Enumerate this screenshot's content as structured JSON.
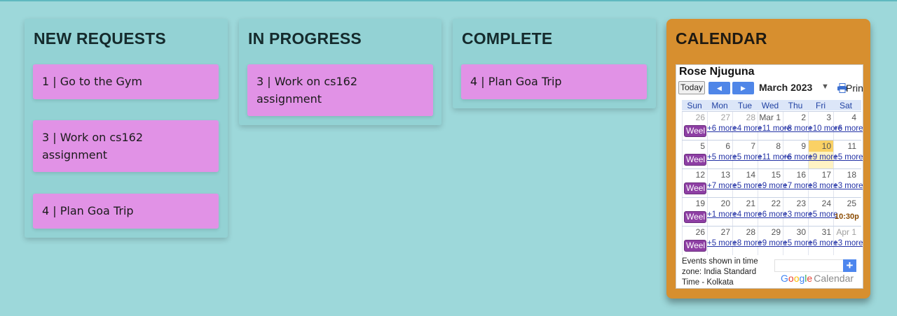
{
  "columns": [
    {
      "title": "NEW REQUESTS",
      "cards": [
        "1 | Go to the Gym",
        "3 | Work on cs162 assignment",
        "4 | Plan Goa Trip"
      ]
    },
    {
      "title": "IN PROGRESS",
      "cards": [
        "3 | Work on cs162 assignment"
      ]
    },
    {
      "title": "COMPLETE",
      "cards": [
        "4 | Plan Goa Trip"
      ]
    }
  ],
  "calendar": {
    "title": "CALENDAR",
    "owner": "Rose Njuguna",
    "today_label": "Today",
    "month_label": "March 2023",
    "print_label": "Print",
    "weekdays": [
      "Sun",
      "Mon",
      "Tue",
      "Wed",
      "Thu",
      "Fri",
      "Sat"
    ],
    "week_badge": "Weel",
    "weeks": [
      {
        "days": [
          "26",
          "27",
          "28",
          "Mar 1",
          "2",
          "3",
          "4"
        ],
        "more": [
          "+6 more",
          "+4 more",
          "+11 more",
          "+8 more",
          "+10 more",
          "+6 more"
        ],
        "time_event": ""
      },
      {
        "days": [
          "5",
          "6",
          "7",
          "8",
          "9",
          "10",
          "11"
        ],
        "more": [
          "+5 more",
          "+5 more",
          "+11 more",
          "+6 more",
          "+9 more",
          "+5 more"
        ],
        "time_event": ""
      },
      {
        "days": [
          "12",
          "13",
          "14",
          "15",
          "16",
          "17",
          "18"
        ],
        "more": [
          "+7 more",
          "+5 more",
          "+9 more",
          "+7 more",
          "+8 more",
          "+3 more"
        ],
        "time_event": ""
      },
      {
        "days": [
          "19",
          "20",
          "21",
          "22",
          "23",
          "24",
          "25"
        ],
        "more": [
          "+1 more",
          "+4 more",
          "+6 more",
          "+3 more",
          "+5 more"
        ],
        "time_event": "10:30p"
      },
      {
        "days": [
          "26",
          "27",
          "28",
          "29",
          "30",
          "31",
          "Apr 1"
        ],
        "more": [
          "+5 more",
          "+8 more",
          "+9 more",
          "+5 more",
          "+6 more",
          "+3 more"
        ],
        "time_event": ""
      }
    ],
    "timezone_note": "Events shown in time zone: India Standard Time - Kolkata",
    "add_button": "+",
    "logo_text": "Google",
    "logo_suffix": "Calendar",
    "colors": {
      "panel": "#d78f2f",
      "card": "#e192e6",
      "background": "#9dd8da",
      "accent_blue": "#4f86e8",
      "today_highlight": "#fad165"
    }
  }
}
